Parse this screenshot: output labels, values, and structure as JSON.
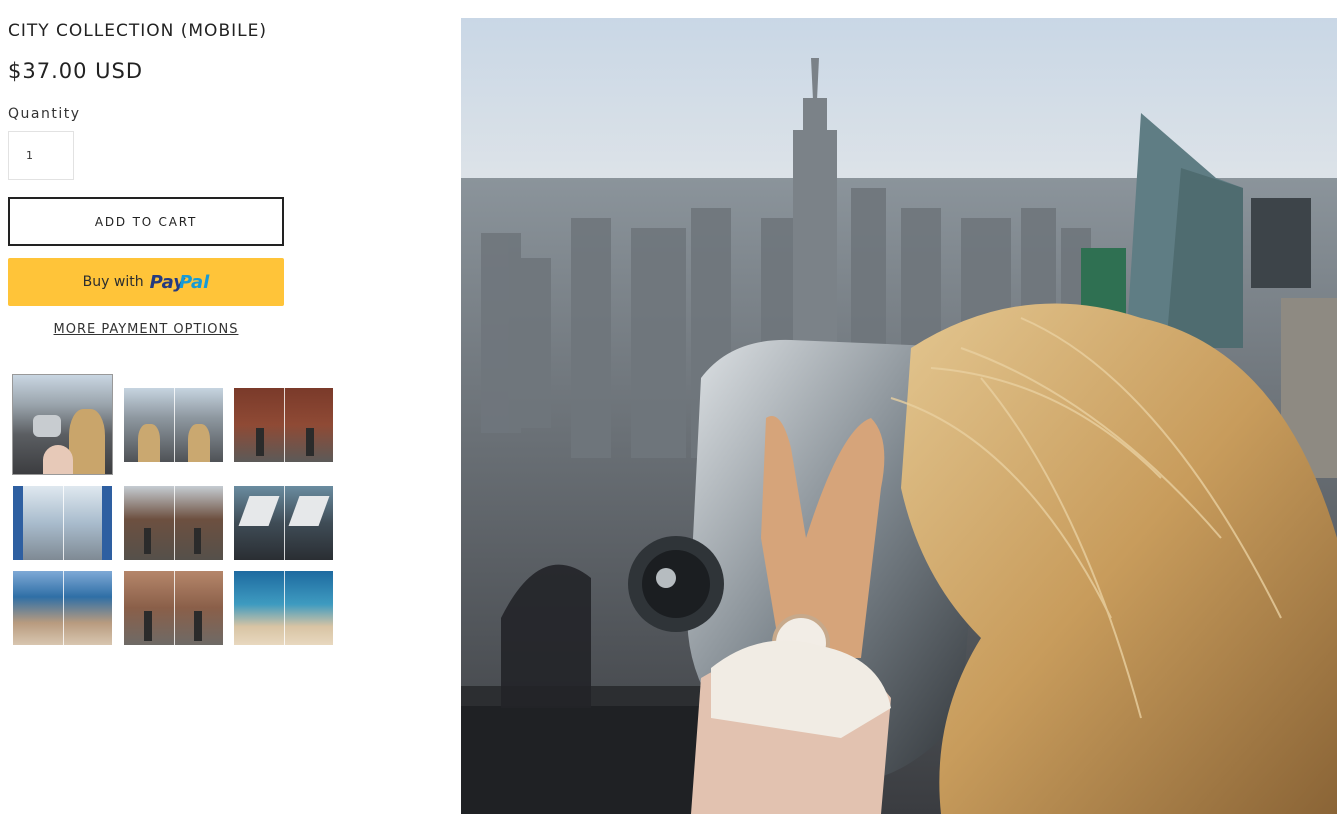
{
  "product": {
    "title": "CITY COLLECTION (MOBILE)",
    "price": "$37.00 USD",
    "quantity_label": "Quantity",
    "quantity_value": "1",
    "add_to_cart_label": "ADD TO CART",
    "paypal_prefix": "Buy with",
    "paypal_brand_1": "Pay",
    "paypal_brand_2": "Pal",
    "more_payment_label": "MORE PAYMENT OPTIONS"
  },
  "colors": {
    "paypal_button": "#ffc439",
    "paypal_dark_blue": "#253b80",
    "paypal_light_blue": "#179bd7",
    "border_dark": "#222222"
  },
  "thumbnails": [
    {
      "name": "thumb-rooftop-binoculars",
      "active": true
    },
    {
      "name": "thumb-rooftop-split",
      "active": false
    },
    {
      "name": "thumb-street-brick-split",
      "active": false
    },
    {
      "name": "thumb-white-alley-split",
      "active": false
    },
    {
      "name": "thumb-bridge-street-split",
      "active": false
    },
    {
      "name": "thumb-boat-split",
      "active": false
    },
    {
      "name": "thumb-coast-cliffs-split",
      "active": false
    },
    {
      "name": "thumb-city-walk-split",
      "active": false
    },
    {
      "name": "thumb-beach-split",
      "active": false
    }
  ]
}
